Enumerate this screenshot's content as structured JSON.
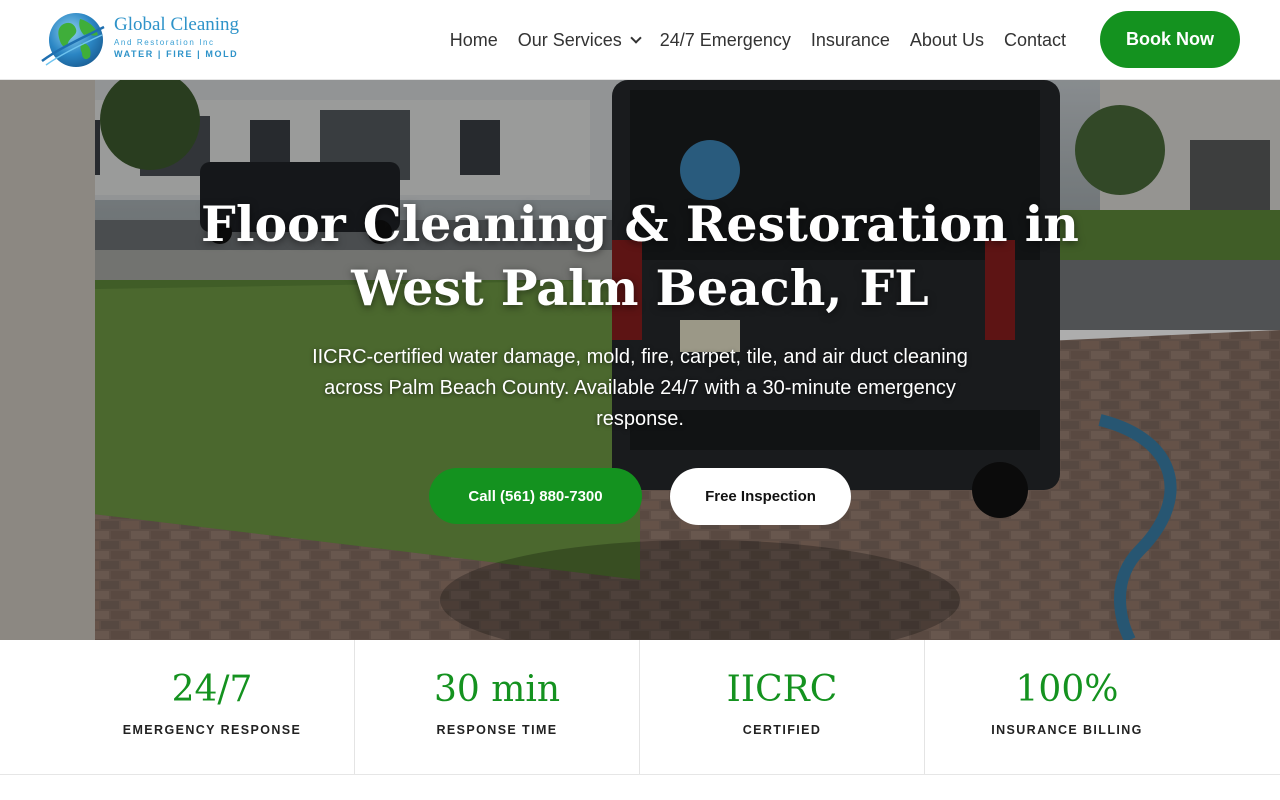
{
  "brand": {
    "name": "Global Cleaning",
    "subtitle": "And Restoration Inc",
    "tags": "WATER | FIRE | MOLD"
  },
  "nav": {
    "items": [
      {
        "label": "Home"
      },
      {
        "label": "Our Services"
      },
      {
        "label": "24/7 Emergency"
      },
      {
        "label": "Insurance"
      },
      {
        "label": "About Us"
      },
      {
        "label": "Contact"
      }
    ],
    "cta": "Book Now"
  },
  "hero": {
    "title_line1": "Floor Cleaning & Restoration in",
    "title_line2": "West Palm Beach, FL",
    "subtitle": "IICRC-certified water damage, mold, fire, carpet, tile, and air duct cleaning across Palm Beach County. Available 24/7 with a 30-minute emergency response.",
    "primary_button": "Call (561) 880-7300",
    "secondary_button": "Free Inspection"
  },
  "stats": [
    {
      "value": "24/7",
      "label": "EMERGENCY RESPONSE"
    },
    {
      "value": "30 min",
      "label": "RESPONSE TIME"
    },
    {
      "value": "IICRC",
      "label": "CERTIFIED"
    },
    {
      "value": "100%",
      "label": "INSURANCE BILLING"
    }
  ],
  "colors": {
    "accent_green": "#14921f",
    "logo_blue": "#2e93c9"
  }
}
